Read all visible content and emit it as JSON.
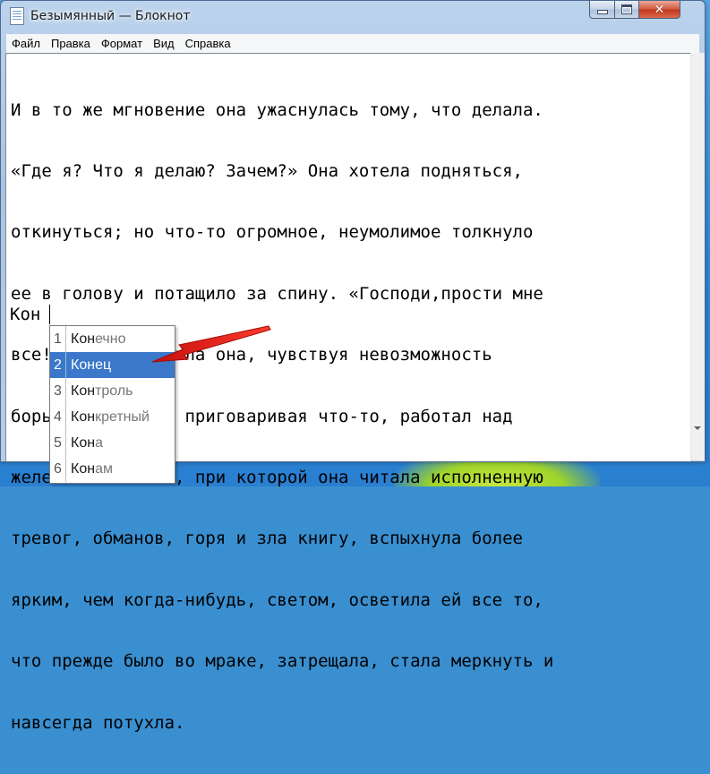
{
  "window": {
    "title": "Безымянный — Блокнот"
  },
  "menu": [
    "Файл",
    "Правка",
    "Формат",
    "Вид",
    "Справка"
  ],
  "document": {
    "lines": [
      "И в то же мгновение она ужаснулась тому, что делала.",
      "«Где я? Что я делаю? Зачем?» Она хотела подняться,",
      "откинуться; но что-то огромное, неумолимое толкнуло",
      "ее в голову и потащило за спину. «Господи,прости мне",
      "все!» – проговорила она, чувствуя невозможность",
      "борьбы. Мужичок, приговаривая что-то, работал над",
      "железом. И свеча, при которой она читала исполненную",
      "тревог, обманов, горя и зла книгу, вспыхнула более",
      "ярким, чем когда-нибудь, светом, осветила ей все то,",
      "что прежде было во мраке, затрещала, стала меркнуть и",
      "навсегда потухла."
    ],
    "typed": "Кон"
  },
  "suggestions": {
    "prefix": "Кон",
    "selected_index": 1,
    "items": [
      {
        "num": "1",
        "prefix": "Кон",
        "rest": "ечно"
      },
      {
        "num": "2",
        "prefix": "Кон",
        "rest": "ец"
      },
      {
        "num": "3",
        "prefix": "Кон",
        "rest": "троль"
      },
      {
        "num": "4",
        "prefix": "Кон",
        "rest": "кретный"
      },
      {
        "num": "5",
        "prefix": "Кон",
        "rest": "а"
      },
      {
        "num": "6",
        "prefix": "Кон",
        "rest": "ам"
      }
    ]
  },
  "colors": {
    "selection": "#3b78c9",
    "annotation_arrow": "#e8201c"
  }
}
